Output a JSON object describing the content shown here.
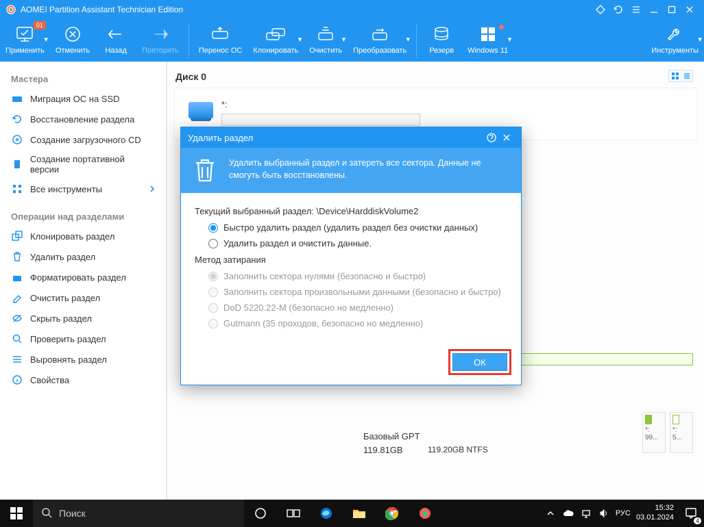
{
  "window": {
    "title": "AOMEI Partition Assistant Technician Edition"
  },
  "toolbar": {
    "apply": "Применить",
    "apply_badge": "01",
    "cancel": "Отменить",
    "back": "Назад",
    "forward": "Повторить",
    "migrate": "Перенос ОС",
    "clone": "Клонировать",
    "wipe": "Очистить",
    "convert": "Преобразовать",
    "backup": "Резерв",
    "win11": "Windows 11",
    "tools": "Инструменты"
  },
  "sidebar": {
    "wizards_title": "Мастера",
    "wizards": [
      "Миграция ОС на SSD",
      "Восстановление раздела",
      "Создание загрузочного CD",
      "Создание портативной версии",
      "Все инструменты"
    ],
    "ops_title": "Операции над разделами",
    "ops": [
      "Клонировать раздел",
      "Удалить раздел",
      "Форматировать раздел",
      "Очистить раздел",
      "Скрыть раздел",
      "Проверить раздел",
      "Выровнять раздел",
      "Свойства"
    ]
  },
  "content": {
    "disk_title": "Диск 0",
    "star_label": "*:",
    "summary_line1": "Базовый GPT",
    "summary_line2": "119.81GB",
    "part_ntfs": "119.20GB NTFS",
    "mini1_top": "*:",
    "mini1_bot": "99...",
    "mini2_top": "*:",
    "mini2_bot": "5..."
  },
  "dialog": {
    "title": "Удалить раздел",
    "header_text": "Удалить выбранный раздел и затереть все сектора. Данные не смогуть быть восстановлены.",
    "current_label": "Текущий выбранный раздел:",
    "current_value": "\\Device\\HarddiskVolume2",
    "opt_quick": "Быстро удалить раздел (удалить раздел без очистки данных)",
    "opt_wipe": "Удалить раздел и очистить данные.",
    "wipe_method_label": "Метод затирания",
    "m_zeros": "Заполнить сектора нулями (безопасно и быстро)",
    "m_random": "Заполнить сектора произвольными данными (безопасно и быстро)",
    "m_dod": "DoD 5220.22-M (безопасно но медленно)",
    "m_gutmann": "Gutmann (35 проходов, безопасно но медленно)",
    "ok": "ОК"
  },
  "taskbar": {
    "search_placeholder": "Поиск",
    "lang": "РУС",
    "time": "15:32",
    "date": "03.01.2024",
    "notif_count": "4"
  }
}
